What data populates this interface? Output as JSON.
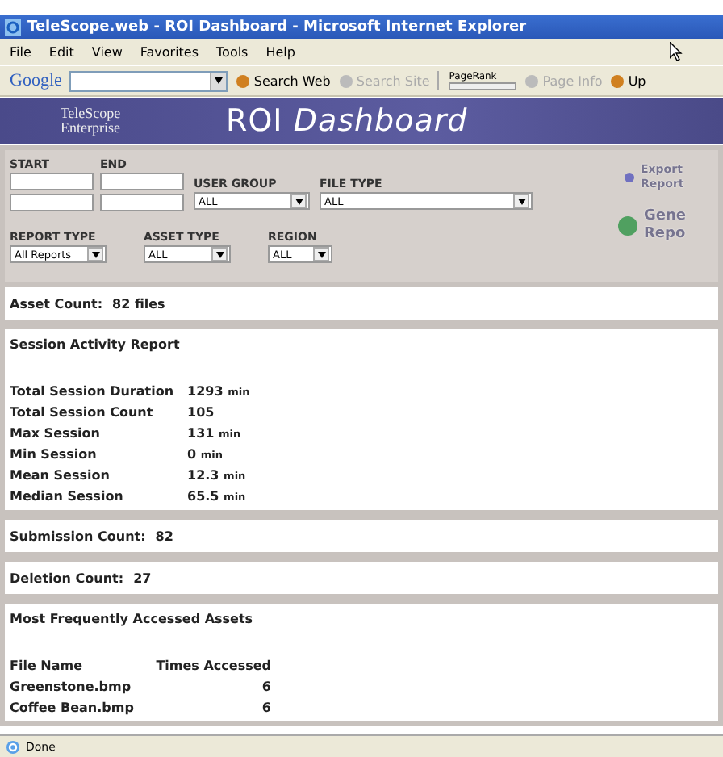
{
  "window": {
    "title": "TeleScope.web - ROI Dashboard - Microsoft Internet Explorer"
  },
  "menu": [
    "File",
    "Edit",
    "View",
    "Favorites",
    "Tools",
    "Help"
  ],
  "toolbar": {
    "brand": "Google",
    "items": [
      {
        "kind": "button",
        "label": "Search Web",
        "disabled": false
      },
      {
        "kind": "button",
        "label": "Search Site",
        "disabled": true
      },
      {
        "kind": "meter",
        "label": "PageRank"
      },
      {
        "kind": "button",
        "label": "Page Info",
        "disabled": true
      },
      {
        "kind": "button",
        "label": "Up",
        "disabled": false
      }
    ]
  },
  "banner": {
    "logo_top": "TeleScope",
    "logo_bottom": "Enterprise",
    "title": "ROI *Dashboard*"
  },
  "filters": {
    "dates": [
      {
        "label": "START"
      },
      {
        "label": "END"
      }
    ],
    "selects_top": [
      {
        "label": "USER GROUP",
        "value": "ALL"
      },
      {
        "label": "FILE TYPE",
        "value": "ALL"
      }
    ],
    "selects_bottom": [
      {
        "label": "REPORT TYPE",
        "value": "All Reports"
      },
      {
        "label": "ASSET TYPE",
        "value": "ALL"
      },
      {
        "label": "REGION",
        "value": "ALL"
      }
    ],
    "actions": [
      {
        "label_1": "Export",
        "label_2": "Report",
        "color": "#7070c0"
      },
      {
        "label_1": "Gene",
        "label_2": "Repo",
        "color": "#50a060"
      }
    ]
  },
  "asset_count": {
    "label": "Asset Count:",
    "value": "82 files"
  },
  "session_report": {
    "title": "Session Activity Report",
    "rows": [
      {
        "label": "Total Session Duration",
        "value": "1293",
        "unit": "min"
      },
      {
        "label": "Total Session Count",
        "value": "105"
      },
      {
        "label": "Max Session",
        "value": "131",
        "unit": "min"
      },
      {
        "label": "Min Session",
        "value": "0",
        "unit": "min"
      },
      {
        "label": "Mean Session",
        "value": "12.3",
        "unit": "min"
      },
      {
        "label": "Median Session",
        "value": "65.5",
        "unit": "min"
      }
    ]
  },
  "submission_count": {
    "label": "Submission Count:",
    "value": "82"
  },
  "deletion_count": {
    "label": "Deletion Count:",
    "value": "27"
  },
  "assets": {
    "title": "Most Frequently Accessed Assets",
    "columns": [
      "File Name",
      "Times Accessed"
    ],
    "rows": [
      [
        "Greenstone.bmp",
        "6"
      ],
      [
        "Coffee Bean.bmp",
        "6"
      ]
    ]
  },
  "status_bar": {
    "text": "Done"
  }
}
